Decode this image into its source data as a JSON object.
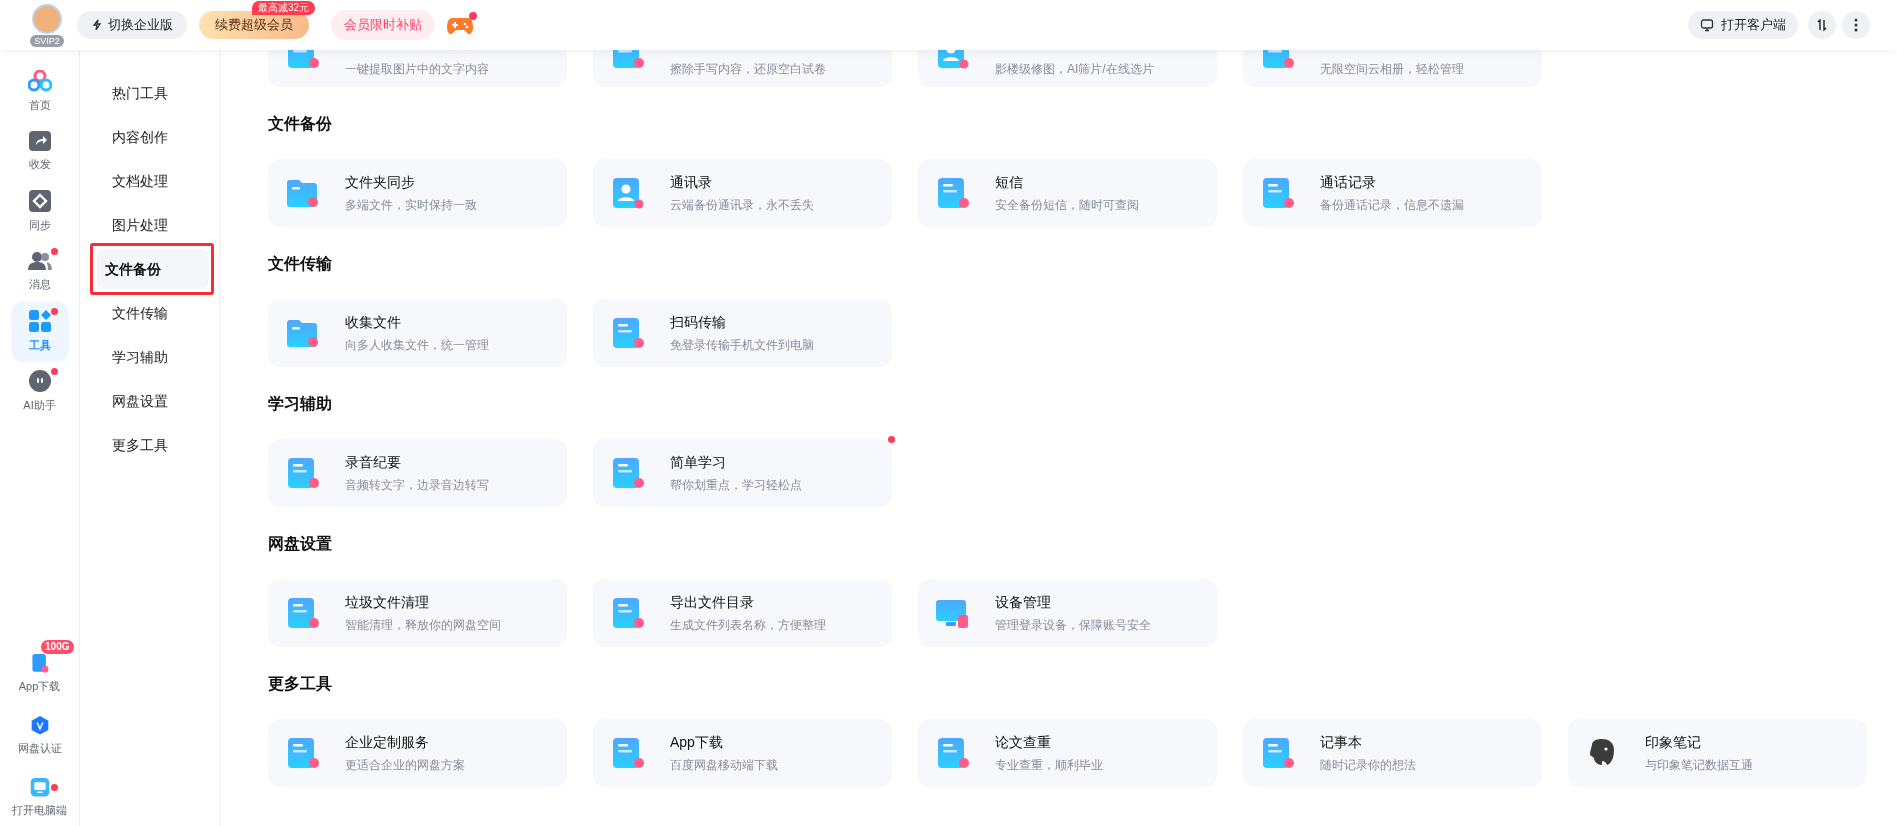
{
  "header": {
    "avatar_badge": "SVIP2",
    "buttons": [
      {
        "kind": "switch",
        "label": "切换企业版"
      },
      {
        "kind": "renew",
        "label": "续费超级会员",
        "badge": "最高减32元"
      },
      {
        "kind": "promo",
        "label": "会员限时补贴"
      }
    ],
    "game_dot": true,
    "client_label": "打开客户端"
  },
  "rail": {
    "top": [
      {
        "label": "首页",
        "selected": false,
        "dot": false
      },
      {
        "label": "收发",
        "selected": false,
        "dot": false
      },
      {
        "label": "同步",
        "selected": false,
        "dot": false
      },
      {
        "label": "消息",
        "selected": false,
        "dot": true
      },
      {
        "label": "工具",
        "selected": true,
        "dot": true
      },
      {
        "label": "AI助手",
        "selected": false,
        "dot": true
      }
    ],
    "bottom": [
      {
        "label": "App下载",
        "dot": false,
        "badge": "100G"
      },
      {
        "label": "网盘认证",
        "dot": false
      },
      {
        "label": "打开电脑端",
        "dot": true
      }
    ]
  },
  "sidebar": {
    "items": [
      {
        "label": "热门工具",
        "selected": false
      },
      {
        "label": "内容创作",
        "selected": false
      },
      {
        "label": "文档处理",
        "selected": false
      },
      {
        "label": "图片处理",
        "selected": false
      },
      {
        "label": "文件备份",
        "selected": true
      },
      {
        "label": "文件传输",
        "selected": false
      },
      {
        "label": "学习辅助",
        "selected": false
      },
      {
        "label": "网盘设置",
        "selected": false
      },
      {
        "label": "更多工具",
        "selected": false
      }
    ]
  },
  "partial_row": [
    {
      "description": "一键提取图片中的文字内容"
    },
    {
      "description": "擦除手写内容，还原空白试卷"
    },
    {
      "description": "影楼级修图，AI筛片/在线选片"
    },
    {
      "description": "无限空间云相册，轻松管理"
    }
  ],
  "sections": [
    {
      "title": "文件备份",
      "cards": [
        {
          "title": "文件夹同步",
          "description": "多端文件，实时保持一致",
          "dot": false
        },
        {
          "title": "通讯录",
          "description": "云端备份通讯录，永不丢失",
          "dot": false
        },
        {
          "title": "短信",
          "description": "安全备份短信，随时可查阅",
          "dot": false
        },
        {
          "title": "通话记录",
          "description": "备份通话记录，信息不遗漏",
          "dot": false
        }
      ]
    },
    {
      "title": "文件传输",
      "cards": [
        {
          "title": "收集文件",
          "description": "向多人收集文件，统一管理",
          "dot": false
        },
        {
          "title": "扫码传输",
          "description": "免登录传输手机文件到电脑",
          "dot": false
        }
      ]
    },
    {
      "title": "学习辅助",
      "cards": [
        {
          "title": "录音纪要",
          "description": "音频转文字，边录音边转写",
          "dot": false
        },
        {
          "title": "简单学习",
          "description": "帮你划重点，学习轻松点",
          "dot": true
        }
      ]
    },
    {
      "title": "网盘设置",
      "cards": [
        {
          "title": "垃圾文件清理",
          "description": "智能清理，释放你的网盘空间",
          "dot": false
        },
        {
          "title": "导出文件目录",
          "description": "生成文件列表名称，方便整理",
          "dot": false
        },
        {
          "title": "设备管理",
          "description": "管理登录设备，保障账号安全",
          "dot": false
        }
      ]
    },
    {
      "title": "更多工具",
      "cards": [
        {
          "title": "企业定制服务",
          "description": "更适合企业的网盘方案",
          "dot": false
        },
        {
          "title": "App下载",
          "description": "百度网盘移动端下载",
          "dot": false
        },
        {
          "title": "论文查重",
          "description": "专业查重，顺利毕业",
          "dot": false
        },
        {
          "title": "记事本",
          "description": "随时记录你的想法",
          "dot": false
        },
        {
          "title": "印象笔记",
          "description": "与印象笔记数据互通",
          "dot": false
        }
      ]
    }
  ]
}
